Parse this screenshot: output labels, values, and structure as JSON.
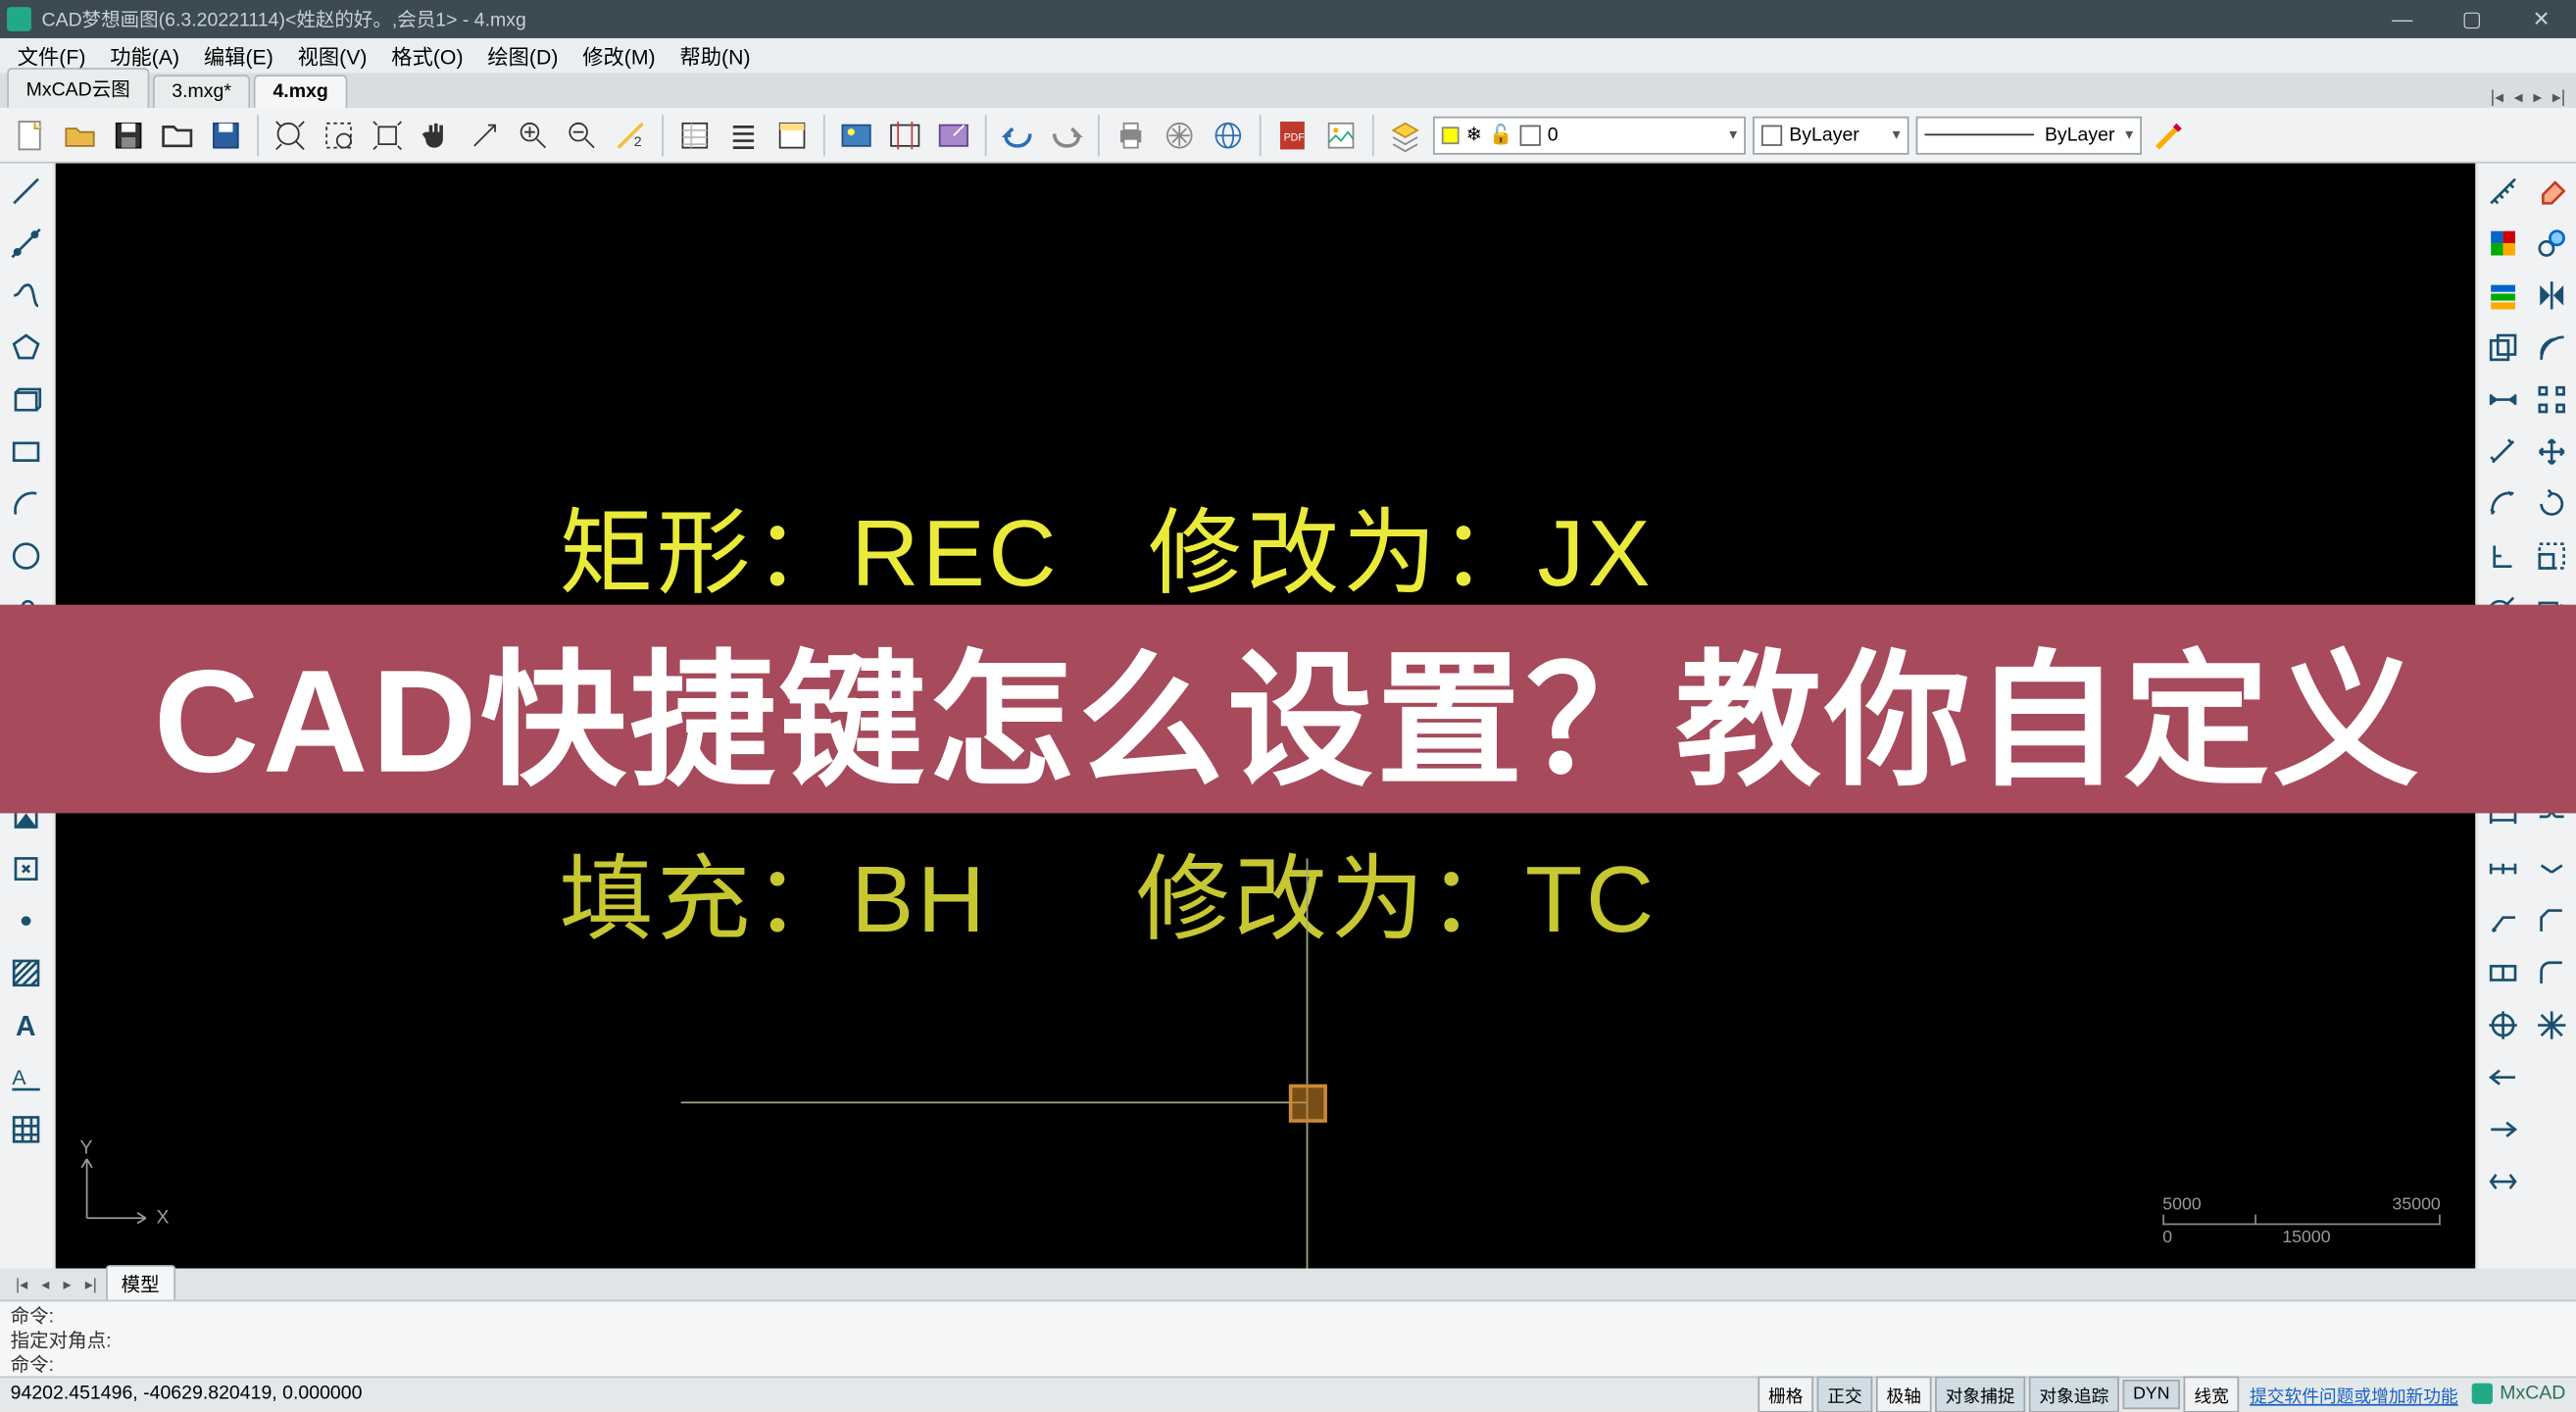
{
  "title": "CAD梦想画图(6.3.20221114)<姓赵的好。,会员1> - 4.mxg",
  "menu": [
    "文件(F)",
    "功能(A)",
    "编辑(E)",
    "视图(V)",
    "格式(O)",
    "绘图(D)",
    "修改(M)",
    "帮助(N)"
  ],
  "doc_tabs": [
    {
      "label": "MxCAD云图",
      "active": false
    },
    {
      "label": "3.mxg*",
      "active": false
    },
    {
      "label": "4.mxg",
      "active": true
    }
  ],
  "layer_combo": {
    "current": "0"
  },
  "color_combo": {
    "current": "ByLayer"
  },
  "linetype_combo": {
    "current": "ByLayer"
  },
  "drawing": {
    "line1_left": "矩形：REC",
    "line1_right": "修改为：JX",
    "line2_left": "填充：BH",
    "line2_right": "修改为：TC"
  },
  "overlay": "CAD快捷键怎么设置？教你自定义",
  "scale": {
    "left": "5000",
    "right": "35000",
    "mid": "15000",
    "zero": "0"
  },
  "ucs": {
    "x": "X",
    "y": "Y"
  },
  "bottom_tabs": [
    "模型"
  ],
  "cmd": {
    "l1": "命令:",
    "l2": "指定对角点:",
    "l3": "命令:"
  },
  "status": {
    "coords": "94202.451496,  -40629.820419,  0.000000",
    "toggles": [
      {
        "label": "栅格",
        "on": false
      },
      {
        "label": "正交",
        "on": true
      },
      {
        "label": "极轴",
        "on": false
      },
      {
        "label": "对象捕捉",
        "on": true
      },
      {
        "label": "对象追踪",
        "on": true
      },
      {
        "label": "DYN",
        "on": true
      },
      {
        "label": "线宽",
        "on": false
      }
    ],
    "link": "提交软件问题或增加新功能",
    "brand": "MxCAD"
  }
}
